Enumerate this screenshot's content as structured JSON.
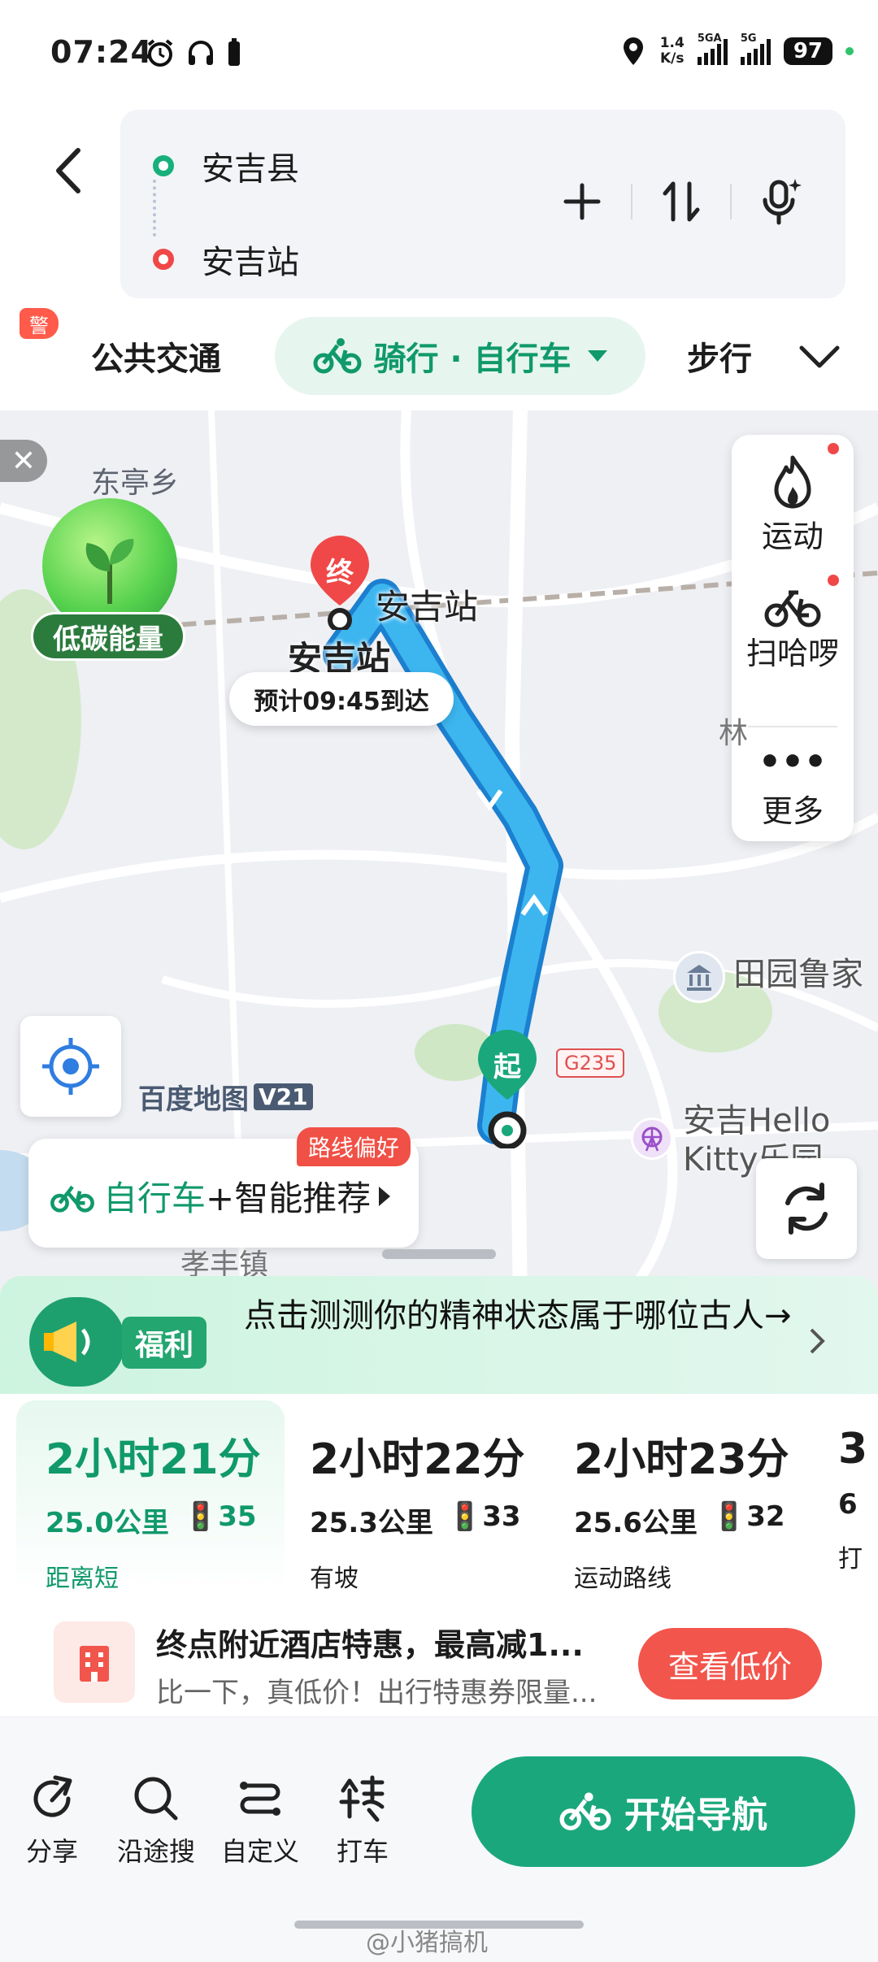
{
  "status": {
    "time": "07:24",
    "net_speed_top": "1.4",
    "net_speed_bottom": "K/s",
    "sig1_label": "5GA",
    "sig2_label": "5G",
    "battery": "97"
  },
  "route": {
    "from": "安吉县",
    "to": "安吉站"
  },
  "alert_badge": "警",
  "modes": {
    "transit": "公共交通",
    "bike": "骑行 · 自行车",
    "walk": "步行"
  },
  "map": {
    "close": "✕",
    "village_dongting": "东亭乡",
    "low_carbon": "低碳能量",
    "end_marker": "终",
    "start_marker": "起",
    "station_poi": "安吉站",
    "station_label": "安吉站",
    "eta": "预计09:45到达",
    "side_sport": "运动",
    "side_bike": "扫哈啰",
    "side_more": "更多",
    "partial_char": "林",
    "poi_tianyuan": "田园鲁家",
    "road": "G235",
    "poi_hello_kitty_1": "安吉Hello",
    "poi_hello_kitty_2": "Kitty乐园",
    "brand": "百度地图",
    "brand_version": "V21",
    "pref_label_green": "自行车",
    "pref_label_rest": "+智能推荐",
    "pref_badge": "路线偏好",
    "town": "孝丰镇"
  },
  "promo": {
    "tag": "福利",
    "text": "点击测测你的精神状态属于哪位古人→"
  },
  "options": [
    {
      "duration": "2小时21分",
      "distance": "25.0公里",
      "lights": "35",
      "tag": "距离短"
    },
    {
      "duration": "2小时22分",
      "distance": "25.3公里",
      "lights": "33",
      "tag": "有坡"
    },
    {
      "duration": "2小时23分",
      "distance": "25.6公里",
      "lights": "32",
      "tag": "运动路线"
    },
    {
      "duration": "3",
      "distance": "6",
      "lights": "",
      "tag": "打"
    }
  ],
  "hotel": {
    "title": "终点附近酒店特惠，最高减1...",
    "subtitle": "比一下，真低价！出行特惠券限量...",
    "button": "查看低价"
  },
  "actions": {
    "share": "分享",
    "search_along": "沿途搜",
    "customize": "自定义",
    "taxi": "打车",
    "start": "开始导航"
  },
  "watermark": "@小猪搞机",
  "colors": {
    "accent": "#10996b",
    "route": "#2aa7e8",
    "alert": "#f04848"
  }
}
